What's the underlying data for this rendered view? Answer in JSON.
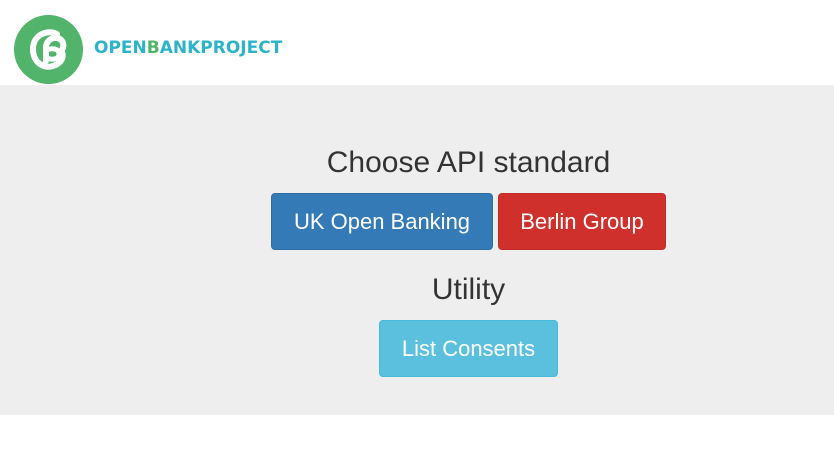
{
  "header": {
    "logo_text_part1": "OPEN",
    "logo_text_part2": "B",
    "logo_text_part3": "ANKPROJECT",
    "logo_colors": {
      "teal": "#2bb3c9",
      "green": "#52b36b"
    }
  },
  "main": {
    "api_heading": "Choose API standard",
    "buttons": {
      "uk_open_banking": "UK Open Banking",
      "berlin_group": "Berlin Group"
    },
    "utility_heading": "Utility",
    "utility_buttons": {
      "list_consents": "List Consents"
    }
  },
  "colors": {
    "primary": "#337ab7",
    "danger": "#d0302b",
    "info": "#5bc0de",
    "panel_background": "#eeeeee"
  }
}
